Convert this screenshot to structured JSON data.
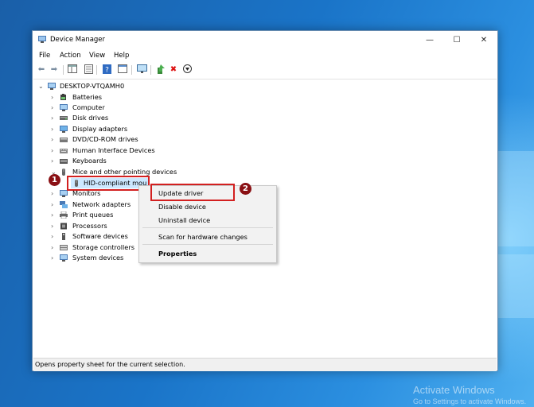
{
  "window": {
    "title": "Device Manager",
    "controls": {
      "minimize": "—",
      "maximize": "☐",
      "close": "✕"
    }
  },
  "menu": [
    "File",
    "Action",
    "View",
    "Help"
  ],
  "toolbar_icons": [
    "back-arrow-icon",
    "forward-arrow-icon",
    "console-tree-icon",
    "properties-icon",
    "help-icon",
    "view-icon",
    "scan-hardware-icon",
    "update-driver-icon",
    "uninstall-icon",
    "disable-icon"
  ],
  "tree": {
    "root": "DESKTOP-VTQAMH0",
    "items": [
      {
        "label": "Batteries"
      },
      {
        "label": "Computer"
      },
      {
        "label": "Disk drives"
      },
      {
        "label": "Display adapters"
      },
      {
        "label": "DVD/CD-ROM drives"
      },
      {
        "label": "Human Interface Devices"
      },
      {
        "label": "Keyboards"
      },
      {
        "label": "Mice and other pointing devices",
        "expanded": true
      },
      {
        "label": "HID-compliant mou",
        "child": true,
        "selected": true
      },
      {
        "label": "Monitors"
      },
      {
        "label": "Network adapters"
      },
      {
        "label": "Print queues"
      },
      {
        "label": "Processors"
      },
      {
        "label": "Software devices"
      },
      {
        "label": "Storage controllers"
      },
      {
        "label": "System devices"
      }
    ]
  },
  "context_menu": {
    "update": "Update driver",
    "disable": "Disable device",
    "uninstall": "Uninstall device",
    "scan": "Scan for hardware changes",
    "properties": "Properties"
  },
  "annotations": {
    "step1": "1",
    "step2": "2"
  },
  "status_bar": "Opens property sheet for the current selection.",
  "watermark": {
    "line1": "Activate Windows",
    "line2": "Go to Settings to activate Windows."
  },
  "colors": {
    "highlight_box": "#d32020",
    "step_badge": "#8a1014",
    "desktop": "#1a74c8"
  }
}
